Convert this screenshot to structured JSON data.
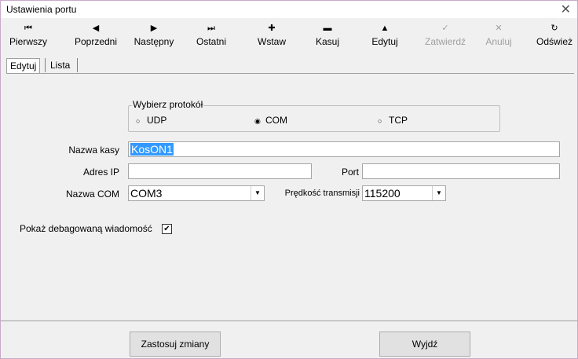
{
  "window": {
    "title": "Ustawienia portu",
    "close_glyph": "✕"
  },
  "toolbar": {
    "items": [
      {
        "icon": "first-icon",
        "glyph": "⏮",
        "label": "Pierwszy",
        "enabled": true
      },
      {
        "icon": "previous-icon",
        "glyph": "◀",
        "label": "Poprzedni",
        "enabled": true
      },
      {
        "icon": "next-icon",
        "glyph": "▶",
        "label": "Następny",
        "enabled": true
      },
      {
        "icon": "last-icon",
        "glyph": "⏭",
        "label": "Ostatni",
        "enabled": true
      },
      {
        "icon": "insert-icon",
        "glyph": "✚",
        "label": "Wstaw",
        "enabled": true
      },
      {
        "icon": "delete-icon",
        "glyph": "▬",
        "label": "Kasuj",
        "enabled": true
      },
      {
        "icon": "edit-icon",
        "glyph": "▲",
        "label": "Edytuj",
        "enabled": true
      },
      {
        "icon": "confirm-icon",
        "glyph": "✓",
        "label": "Zatwierdź",
        "enabled": false
      },
      {
        "icon": "cancel-icon",
        "glyph": "✕",
        "label": "Anuluj",
        "enabled": false
      },
      {
        "icon": "refresh-icon",
        "glyph": "↻",
        "label": "Odśwież",
        "enabled": true
      }
    ]
  },
  "tabs": [
    {
      "label": "Edytuj",
      "active": true
    },
    {
      "label": "Lista",
      "active": false
    }
  ],
  "protocol": {
    "legend": "Wybierz protokół",
    "options": [
      {
        "label": "UDP",
        "selected": false
      },
      {
        "label": "COM",
        "selected": true
      },
      {
        "label": "TCP",
        "selected": false
      }
    ]
  },
  "form": {
    "cash_name_label": "Nazwa kasy",
    "cash_name_value": "KosON1",
    "ip_label": "Adres IP",
    "ip_value": "",
    "port_label": "Port",
    "port_value": "",
    "com_label": "Nazwa COM",
    "com_value": "COM3",
    "speed_label": "Prędkość transmisji",
    "speed_value": "115200",
    "debug_label": "Pokaż debagowaną wiadomość",
    "debug_checked": true,
    "check_glyph": "✔",
    "dropdown_glyph": "▼"
  },
  "buttons": {
    "apply_label": "Zastosuj zmiany",
    "exit_label": "Wyjdź"
  }
}
